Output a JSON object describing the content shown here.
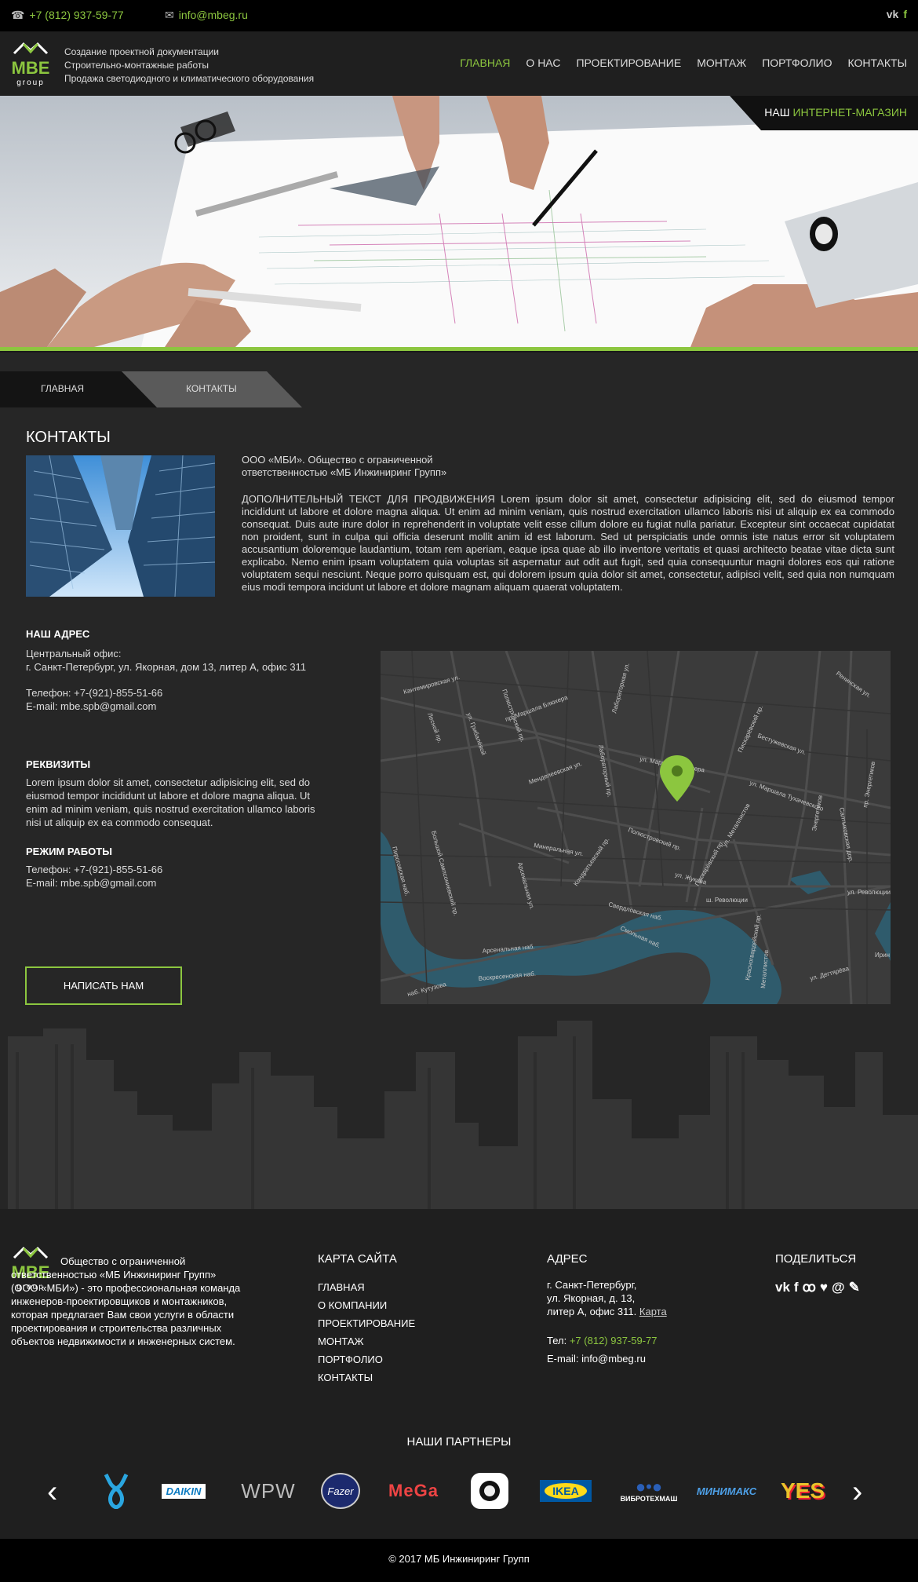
{
  "topbar": {
    "phone": "+7 (812) 937-59-77",
    "email": "info@mbeg.ru",
    "social": [
      "vk-icon",
      "facebook-icon"
    ]
  },
  "header": {
    "logo_text": "MBE",
    "logo_sub": "group",
    "tagline": [
      "Создание проектной документации",
      "Строительно-монтажные работы",
      "Продажа светодиодного и климатического оборудования"
    ],
    "nav": [
      "ГЛАВНАЯ",
      "О НАС",
      "ПРОЕКТИРОВАНИЕ",
      "МОНТАЖ",
      "ПОРТФОЛИО",
      "КОНТАКТЫ"
    ],
    "active_nav": "ГЛАВНАЯ"
  },
  "hero": {
    "shop_prefix": "НАШ",
    "shop_label": "ИНТЕРНЕТ-МАГАЗИН"
  },
  "breadcrumbs": [
    "ГЛАВНАЯ",
    "КОНТАКТЫ"
  ],
  "contacts": {
    "title": "КОНТАКТЫ",
    "company": "ООО «МБИ». Общество с ограниченной ответственностью «МБ Инжиниринг Групп»",
    "promo": "ДОПОЛНИТЕЛЬНЫЙ ТЕКСТ ДЛЯ ПРОДВИЖЕНИЯ Lorem ipsum dolor sit amet, consectetur adipisicing elit, sed do eiusmod tempor incididunt ut labore et dolore magna aliqua. Ut enim ad minim veniam, quis nostrud exercitation ullamco laboris nisi ut aliquip ex ea commodo consequat. Duis aute irure dolor in reprehenderit in voluptate velit esse cillum dolore eu fugiat nulla pariatur. Excepteur sint occaecat cupidatat non proident, sunt in culpa qui officia deserunt mollit anim id est laborum. Sed ut perspiciatis unde omnis iste natus error sit voluptatem accusantium doloremque laudantium, totam rem aperiam, eaque ipsa quae ab illo inventore veritatis et quasi architecto beatae vitae dicta sunt explicabo. Nemo enim ipsam voluptatem quia voluptas sit aspernatur aut odit aut fugit, sed quia consequuntur magni dolores eos qui ratione voluptatem sequi nesciunt. Neque porro quisquam est, qui dolorem ipsum quia dolor sit amet, consectetur, adipisci velit, sed quia non numquam eius modi tempora incidunt ut labore et dolore magnam aliquam quaerat voluptatem.",
    "address_heading": "НАШ АДРЕС",
    "office_label": "Центральный офис:",
    "office_address": "г. Санкт-Петербург, ул. Якорная, дом 13, литер А, офис 311",
    "phone_line": "Телефон: +7-(921)-855-51-66",
    "email_line": "E-mail: mbe.spb@gmail.com",
    "requisites_heading": "РЕКВИЗИТЫ",
    "requisites_text": "Lorem ipsum dolor sit amet, consectetur adipisicing elit, sed do eiusmod tempor incididunt ut labore et dolore magna aliqua. Ut enim ad minim veniam, quis nostrud exercitation ullamco laboris nisi ut aliquip ex ea commodo consequat.",
    "hours_heading": "РЕЖИМ РАБОТЫ",
    "hours_phone": "Телефон: +7-(921)-855-51-66",
    "hours_email": "E-mail: mbe.spb@gmail.com",
    "write_button": "НАПИСАТЬ НАМ"
  },
  "map": {
    "streets": [
      "Кантемировская ул.",
      "Лесной пр.",
      "ул. Грибалёвой",
      "Полюстровский пр.",
      "пр. Маршала Блюхера",
      "Лабораторная ул.",
      "Менделеевская ул.",
      "Лабораторный пр.",
      "ул. Маршала Блюхера",
      "Пискарёвский пр.",
      "Бестужевская ул.",
      "Ренинская ул.",
      "ул. Маршала Тухачевского",
      "Салтыковская дор.",
      "Минеральная ул.",
      "Арсенальная ул.",
      "Кондратьевский пр.",
      "Полюстровский пр.",
      "ул. Жукова",
      "Пискарёвский пр.",
      "ш. Революции",
      "ул. Металлистов",
      "ул. Революции",
      "Свердловская наб.",
      "Смольная наб.",
      "Арсенальная наб.",
      "Воскресенская наб.",
      "наб. Кутузова",
      "Пироговская наб.",
      "Большой Сампсониевский пр.",
      "ул. Дегтярёва",
      "Энергетиков",
      "пр. Энергетиков",
      "Ирин",
      "Металлистов",
      "Красногвардейский пр."
    ]
  },
  "footer": {
    "about": "Общество с ограниченной ответственностью «МБ Инжиниринг Групп» (ООО «МБИ») - это профессиональная команда инженеров-проектировщиков и монтажников, которая предлагает Вам свои услуги в области проектирования и строительства различных объектов недвижимости и инженерных систем.",
    "sitemap_heading": "КАРТА САЙТА",
    "sitemap": [
      "ГЛАВНАЯ",
      "О КОМПАНИИ",
      "ПРОЕКТИРОВАНИЕ",
      "МОНТАЖ",
      "ПОРТФОЛИО",
      "КОНТАКТЫ"
    ],
    "address_heading": "АДРЕС",
    "address_lines": [
      "г. Санкт-Петербург,",
      "ул. Якорная, д. 13,",
      "литер А, офис 311."
    ],
    "map_link": "Карта",
    "tel_label": "Тел:",
    "tel": "+7 (812) 937-59-77",
    "email_label": "E-mail:",
    "email": "info@mbeg.ru",
    "share_heading": "ПОДЕЛИТЬСЯ",
    "share_icons": [
      "vk-icon",
      "facebook-icon",
      "odnoklassniki-icon",
      "twitter-icon",
      "mail-icon",
      "livejournal-icon"
    ],
    "partners_heading": "НАШИ ПАРТНЕРЫ",
    "partners": [
      "DAIKIN",
      "WPW",
      "Fazer",
      "MeGa",
      "IKEA",
      "ВИБРОТЕХМАШ",
      "МИНИМАКС",
      "YES"
    ],
    "copyright": "© 2017 МБ Инжиниринг Групп"
  },
  "colors": {
    "accent": "#8cc63f",
    "background": "#262626",
    "topbar": "#000000"
  }
}
